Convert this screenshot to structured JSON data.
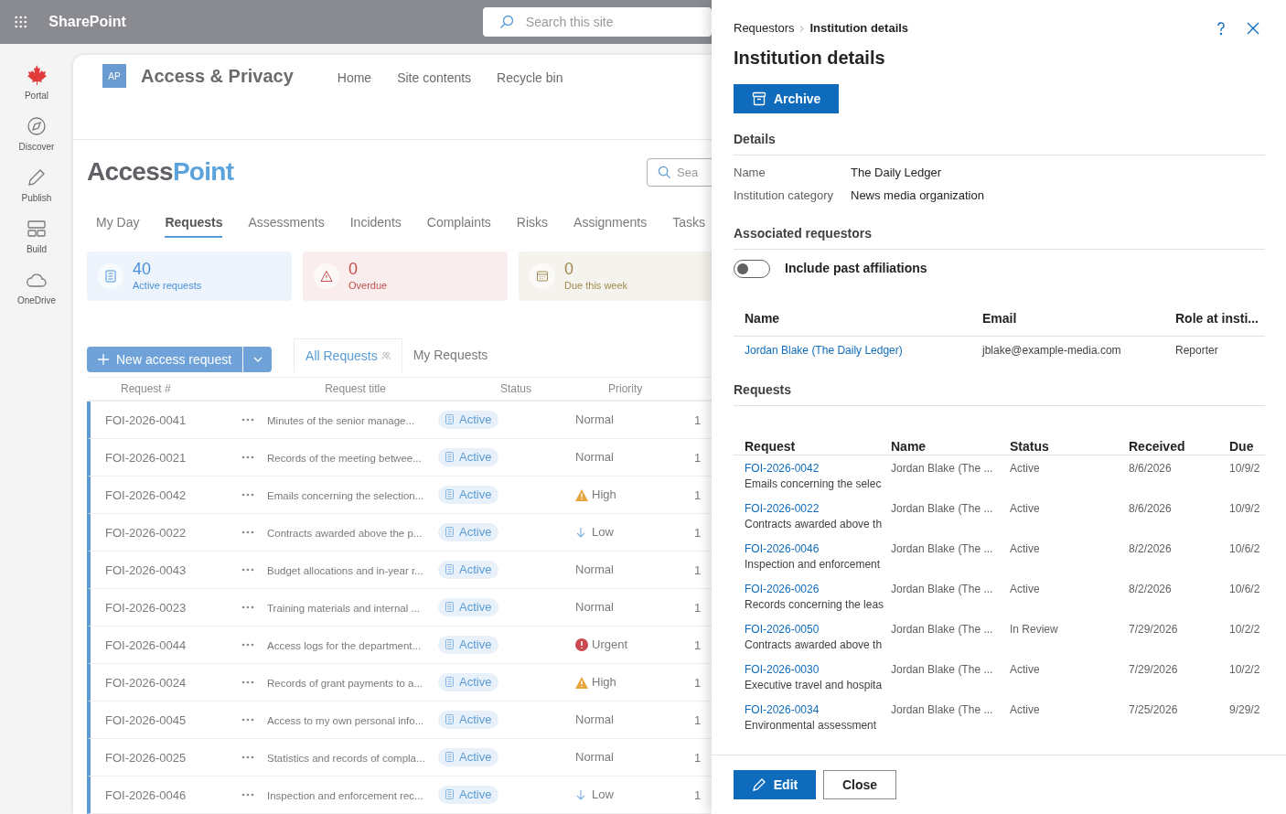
{
  "top_bar": {
    "app_name": "SharePoint",
    "search_placeholder": "Search this site"
  },
  "rail": [
    {
      "label": "Portal"
    },
    {
      "label": "Discover"
    },
    {
      "label": "Publish"
    },
    {
      "label": "Build"
    },
    {
      "label": "OneDrive"
    }
  ],
  "site": {
    "logo": "AP",
    "title": "Access & Privacy",
    "nav": [
      "Home",
      "Site contents",
      "Recycle bin"
    ]
  },
  "brand": {
    "part_1": "Access",
    "part_2": "Point"
  },
  "search_placeholder": "Sea",
  "tabs": [
    {
      "label": "My Day",
      "selected": false
    },
    {
      "label": "Requests",
      "selected": true
    },
    {
      "label": "Assessments",
      "selected": false
    },
    {
      "label": "Incidents",
      "selected": false
    },
    {
      "label": "Complaints",
      "selected": false
    },
    {
      "label": "Risks",
      "selected": false
    },
    {
      "label": "Assignments",
      "selected": false
    },
    {
      "label": "Tasks",
      "selected": false
    }
  ],
  "stats": [
    {
      "value": "40",
      "label": "Active requests",
      "color": "#4a90d9"
    },
    {
      "value": "0",
      "label": "Overdue",
      "color": "#c0504d"
    },
    {
      "value": "0",
      "label": "Due this week",
      "color": "#a08a4f"
    }
  ],
  "toolbar": {
    "new_button": "New access request",
    "views": [
      {
        "label": "All Requests",
        "selected": true
      },
      {
        "label": "My Requests",
        "selected": false
      }
    ]
  },
  "table": {
    "columns": [
      "Request #",
      "Request title",
      "Status",
      "Priority"
    ],
    "rows": [
      {
        "id": "FOI-2026-0041",
        "title": "Minutes of the senior manage...",
        "status": "Active",
        "priority": {
          "kind": "normal",
          "text": "Normal"
        },
        "column_5": "1"
      },
      {
        "id": "FOI-2026-0021",
        "title": "Records of the meeting betwee...",
        "status": "Active",
        "priority": {
          "kind": "normal",
          "text": "Normal"
        },
        "column_5": "1"
      },
      {
        "id": "FOI-2026-0042",
        "title": "Emails concerning the selection...",
        "status": "Active",
        "priority": {
          "kind": "high",
          "text": "High"
        },
        "column_5": "1"
      },
      {
        "id": "FOI-2026-0022",
        "title": "Contracts awarded above the p...",
        "status": "Active",
        "priority": {
          "kind": "low",
          "text": "Low"
        },
        "column_5": "1"
      },
      {
        "id": "FOI-2026-0043",
        "title": "Budget allocations and in-year r...",
        "status": "Active",
        "priority": {
          "kind": "normal",
          "text": "Normal"
        },
        "column_5": "1"
      },
      {
        "id": "FOI-2026-0023",
        "title": "Training materials and internal ...",
        "status": "Active",
        "priority": {
          "kind": "normal",
          "text": "Normal"
        },
        "column_5": "1"
      },
      {
        "id": "FOI-2026-0044",
        "title": "Access logs for the department...",
        "status": "Active",
        "priority": {
          "kind": "urgent",
          "text": "Urgent"
        },
        "column_5": "1"
      },
      {
        "id": "FOI-2026-0024",
        "title": "Records of grant payments to a...",
        "status": "Active",
        "priority": {
          "kind": "high",
          "text": "High"
        },
        "column_5": "1"
      },
      {
        "id": "FOI-2026-0045",
        "title": "Access to my own personal info...",
        "status": "Active",
        "priority": {
          "kind": "normal",
          "text": "Normal"
        },
        "column_5": "1"
      },
      {
        "id": "FOI-2026-0025",
        "title": "Statistics and records of compla...",
        "status": "Active",
        "priority": {
          "kind": "normal",
          "text": "Normal"
        },
        "column_5": "1"
      },
      {
        "id": "FOI-2026-0046",
        "title": "Inspection and enforcement rec...",
        "status": "Active",
        "priority": {
          "kind": "low",
          "text": "Low"
        },
        "column_5": "1"
      }
    ]
  },
  "panel": {
    "breadcrumb": [
      "Requestors",
      "Institution details"
    ],
    "title": "Institution details",
    "archive_button": "Archive",
    "details": {
      "heading": "Details",
      "fields": [
        {
          "label": "Name",
          "value": "The Daily Ledger"
        },
        {
          "label": "Institution category",
          "value": "News media organization"
        }
      ]
    },
    "associated": {
      "heading": "Associated requestors",
      "toggle": {
        "label": "Include past affiliations",
        "on": false
      },
      "columns": [
        "Name",
        "Email",
        "Role at insti..."
      ],
      "rows": [
        {
          "name": "Jordan Blake (The Daily Ledger)",
          "email": "jblake@example-media.com",
          "role": "Reporter"
        }
      ]
    },
    "requests": {
      "heading": "Requests",
      "columns": [
        "Request",
        "Name",
        "Status",
        "Received",
        "Due"
      ],
      "rows": [
        {
          "request": "FOI-2026-0042",
          "title": "Emails concerning the selec",
          "name": "Jordan Blake (The ...",
          "status": "Active",
          "received": "8/6/2026",
          "due": "10/9/2"
        },
        {
          "request": "FOI-2026-0022",
          "title": "Contracts awarded above th",
          "name": "Jordan Blake (The ...",
          "status": "Active",
          "received": "8/6/2026",
          "due": "10/9/2"
        },
        {
          "request": "FOI-2026-0046",
          "title": "Inspection and enforcement",
          "name": "Jordan Blake (The ...",
          "status": "Active",
          "received": "8/2/2026",
          "due": "10/6/2"
        },
        {
          "request": "FOI-2026-0026",
          "title": "Records concerning the leas",
          "name": "Jordan Blake (The ...",
          "status": "Active",
          "received": "8/2/2026",
          "due": "10/6/2"
        },
        {
          "request": "FOI-2026-0050",
          "title": "Contracts awarded above th",
          "name": "Jordan Blake (The ...",
          "status": "In Review",
          "received": "7/29/2026",
          "due": "10/2/2"
        },
        {
          "request": "FOI-2026-0030",
          "title": "Executive travel and hospita",
          "name": "Jordan Blake (The ...",
          "status": "Active",
          "received": "7/29/2026",
          "due": "10/2/2"
        },
        {
          "request": "FOI-2026-0034",
          "title": "Environmental assessment",
          "name": "Jordan Blake (The ...",
          "status": "Active",
          "received": "7/25/2026",
          "due": "9/29/2"
        }
      ]
    },
    "footer": {
      "edit_button": "Edit",
      "close_button": "Close"
    }
  }
}
